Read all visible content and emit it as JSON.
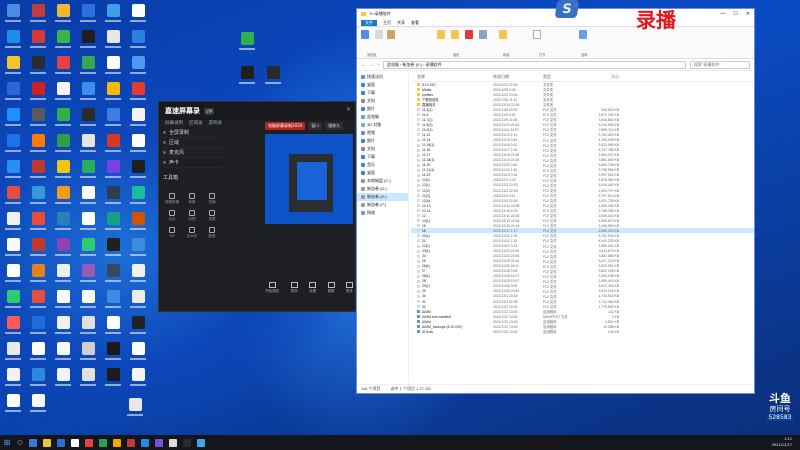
{
  "desktop": {
    "icon_colors": [
      "#4a8de0",
      "#c23d3d",
      "#f2b630",
      "#2f6fdc",
      "#3fa0e6",
      "#ffffff",
      "#1e8ee6",
      "#d33a3a",
      "#39b54a",
      "#1f1f1f",
      "#e7e7e7",
      "#2b7fe0",
      "#f7c12a",
      "#2b2b2b",
      "#e64242",
      "#35a853",
      "#ffffff",
      "#4f9af0",
      "#2a66d8",
      "#cc2222",
      "#f6f6f6",
      "#3f8cf0",
      "#ffb900",
      "#e03c31",
      "#1e90ff",
      "#5a5a5a",
      "#2fb24e",
      "#2b2b2b",
      "#3f7ee0",
      "#f4f4f4",
      "#1a73e8",
      "#ff7a00",
      "#2f9e44",
      "#e6e6e6",
      "#d9381e",
      "#ffffff",
      "#2a8ff2",
      "#c0392b",
      "#f1c40f",
      "#27ae60",
      "#7b3fe4",
      "#1e1e1e",
      "#e84c3d",
      "#3498db",
      "#f39c12",
      "#ffffff",
      "#2c3e50",
      "#1abc9c",
      "#f0f0f0",
      "#e74c3c",
      "#2980b9",
      "#ffffff",
      "#16a085",
      "#d35400",
      "#f9f9f9",
      "#c0392b",
      "#8e44ad",
      "#2ecc71",
      "#1f1f1f",
      "#3c8dde",
      "#ffffff",
      "#e67e22",
      "#ecf0f1",
      "#9b59b6",
      "#34495e",
      "#f1f1f1",
      "#2ecc71",
      "#e74c3c",
      "#ffffff",
      "#ffffff",
      "#3d8be2",
      "#ececec",
      "#ff5a5a",
      "#1d6fe0",
      "#f0f0f0",
      "#e0e0e0",
      "#ffffff",
      "#222222",
      "#eaeaea",
      "#ffffff",
      "#fafafa",
      "#d0d0d0",
      "#1a1a1a",
      "#ffffff",
      "#f2f2f2",
      "#2b8ae0",
      "#f4f4f4",
      "#e0e0e0",
      "#1b1b1b",
      "#f5f5f5",
      "#ffffff",
      "#f9f9f9"
    ]
  },
  "recorder": {
    "brand": "嘉速屏幕录",
    "version": "VIP",
    "tabs": [
      "屏幕录制",
      "区域录",
      "游戏录"
    ],
    "preview_tabs": [
      "电脑屏幕录制2020",
      "窗口",
      "摄像头"
    ],
    "left_items": [
      "全屏录制",
      "区域",
      "麦克风",
      "声卡"
    ],
    "tools_title": "工具箱",
    "tools": [
      "视频剪辑",
      "转换",
      "压缩",
      "合并",
      "分割",
      "录屏",
      "GIF",
      "去水印",
      "配音"
    ],
    "bottom": [
      "开始录制",
      "暂停",
      "设置",
      "摄像",
      "更多"
    ]
  },
  "explorer": {
    "title": "E:\\录播软件",
    "ribbon_tabs": [
      "文件",
      "主页",
      "共享",
      "查看"
    ],
    "ribbon_groups": [
      "剪贴板",
      "组织",
      "新建",
      "打开",
      "选择"
    ],
    "address": "此电脑 › 新加卷 (E:) › 录播软件",
    "search_placeholder": "搜索\"录播软件\"",
    "nav": [
      "快速访问",
      "桌面",
      "下载",
      "文档",
      "图片",
      "此电脑",
      "3D 对象",
      "视频",
      "图片",
      "文档",
      "下载",
      "音乐",
      "桌面",
      "本地磁盘 (C:)",
      "新加卷 (D:)",
      "新加卷 (E:)",
      "新加卷 (F:)",
      "网络"
    ],
    "columns": [
      "名称",
      "修改日期",
      "类型",
      "大小"
    ],
    "rows": [
      {
        "n": "8.10.19C",
        "d": "2021/1/22 22:18",
        "t": "文件夹",
        "s": ""
      },
      {
        "n": "Media",
        "d": "2021/4/28 3:42",
        "t": "文件夹",
        "s": ""
      },
      {
        "n": "profiles",
        "d": "2021/1/22 13:44",
        "t": "文件夹",
        "s": ""
      },
      {
        "n": "下载的插件",
        "d": "2021/7/30 11:11",
        "t": "文件夹",
        "s": ""
      },
      {
        "n": "直播相关",
        "d": "2021/12/14 22:36",
        "t": "文件夹",
        "s": ""
      },
      {
        "n": "11.3(1)",
        "d": "2021/11/8 22:05",
        "t": "FLV 文件",
        "s": "944,522 KB"
      },
      {
        "n": "11.6",
        "d": "2021/11/9 0:25",
        "t": "FLV 文件",
        "s": "2,672,199 KB"
      },
      {
        "n": "11.7(1)",
        "d": "2021/11/9 22:28",
        "t": "FLV 文件",
        "s": "3,046,862 KB"
      },
      {
        "n": "11.8(2)",
        "d": "2021/11/10 22:03",
        "t": "FLV 文件",
        "s": "3,214,550 KB"
      },
      {
        "n": "11.9(1)",
        "d": "2021/11/11 23:57",
        "t": "FLV 文件",
        "s": "2,890,114 KB"
      },
      {
        "n": "11.12",
        "d": "2021/11/13 1:12",
        "t": "FLV 文件",
        "s": "3,751,420 KB"
      },
      {
        "n": "11.14",
        "d": "2021/11/15 0:44",
        "t": "FLV 文件",
        "s": "4,190,305 KB"
      },
      {
        "n": "11.15(1)",
        "d": "2021/11/16 0:31",
        "t": "FLV 文件",
        "s": "3,512,980 KB"
      },
      {
        "n": "11.16",
        "d": "2021/11/17 1:05",
        "t": "FLV 文件",
        "s": "4,247,789 KB"
      },
      {
        "n": "11.17",
        "d": "2021/11/18 22:48",
        "t": "FLV 文件",
        "s": "2,964,207 KB"
      },
      {
        "n": "11.18(1)",
        "d": "2021/11/19 23:19",
        "t": "FLV 文件",
        "s": "3,881,640 KB"
      },
      {
        "n": "11.20",
        "d": "2021/11/21 0:52",
        "t": "FLV 文件",
        "s": "3,684,748 KB"
      },
      {
        "n": "11.21(1)",
        "d": "2021/11/22 1:40",
        "t": "FLV 文件",
        "s": "3,798,556 KB"
      },
      {
        "n": "11.22",
        "d": "2021/11/23 0:16",
        "t": "FLV 文件",
        "s": "2,997,901 KB"
      },
      {
        "n": "12(1)",
        "d": "2021/12/1 1:43",
        "t": "FLV 文件",
        "s": "1,578,381 KB"
      },
      {
        "n": "12(1)",
        "d": "2021/12/2 22:03",
        "t": "FLV 文件",
        "s": "2,016,443 KB"
      },
      {
        "n": "12(2)",
        "d": "2021/12/2 22:18",
        "t": "FLV 文件",
        "s": "1,904,797 KB"
      },
      {
        "n": "12(3)",
        "d": "2021/12/4 0:11",
        "t": "FLV 文件",
        "s": "3,797,510 KB"
      },
      {
        "n": "12(4)",
        "d": "2021/12/5 22:53",
        "t": "FLV 文件",
        "s": "3,001,728 KB"
      },
      {
        "n": "12.13",
        "d": "2021/12/14 22:58",
        "t": "FLV 文件",
        "s": "1,659,180 KB"
      },
      {
        "n": "12.14",
        "d": "2021/12/15 0:03",
        "t": "FLV 文件",
        "s": "2,748,296 KB"
      },
      {
        "n": "12",
        "d": "2021/12/11 22:28",
        "t": "FLV 文件",
        "s": "2,849,320 KB"
      },
      {
        "n": "14(1)",
        "d": "2021/12/13 22:18",
        "t": "FLV 文件",
        "s": "1,839,872 KB"
      },
      {
        "n": "15",
        "d": "2021/12/15 21:44",
        "t": "FLV 文件",
        "s": "2,446,599 KB"
      },
      {
        "n": "16",
        "d": "2021/12/17 1:17",
        "t": "FLV 文件",
        "s": "2,950,316 KB"
      },
      {
        "n": "20(1)",
        "d": "2021/11/21 1:05",
        "t": "FLV 文件",
        "s": "3,752,525 KB"
      },
      {
        "n": "21",
        "d": "2021/11/21 1:32",
        "t": "FLV 文件",
        "s": "4,041,225 KB"
      },
      {
        "n": "22(1)",
        "d": "2021/11/22 0:13",
        "t": "FLV 文件",
        "s": "2,889,401 KB"
      },
      {
        "n": "23(1)",
        "d": "2021/11/23 22:54",
        "t": "FLV 文件",
        "s": "3,113,675 KB"
      },
      {
        "n": "24",
        "d": "2021/11/24 23:56",
        "t": "FLV 文件",
        "s": "3,682,884 KB"
      },
      {
        "n": "25",
        "d": "2021/11/25 23:30",
        "t": "FLV 文件",
        "s": "3,417,223 KB"
      },
      {
        "n": "26(1)",
        "d": "2021/11/26 23:11",
        "t": "FLV 文件",
        "s": "2,823,051 KB"
      },
      {
        "n": "27",
        "d": "2021/11/28 0:05",
        "t": "FLV 文件",
        "s": "3,802,156 KB"
      },
      {
        "n": "28(1)",
        "d": "2021/11/28 14:07",
        "t": "FLV 文件",
        "s": "3,390,208 KB"
      },
      {
        "n": "28",
        "d": "2021/11/29 19:57",
        "t": "FLV 文件",
        "s": "2,995,418 KB"
      },
      {
        "n": "29(1)",
        "d": "2021/11/30 0:09",
        "t": "FLV 文件",
        "s": "2,847,392 KB"
      },
      {
        "n": "29",
        "d": "2021/11/30 23:54",
        "t": "FLV 文件",
        "s": "3,513,224 KB"
      },
      {
        "n": "30",
        "d": "2021/12/1 23:18",
        "t": "FLV 文件",
        "s": "1,744,918 KB"
      },
      {
        "n": "31",
        "d": "2021/12/2 22:38",
        "t": "FLV 文件",
        "s": "1,712,066 KB"
      },
      {
        "n": "32",
        "d": "2021/12/2 22:51",
        "t": "FLV 文件",
        "s": "1,775,690 KB"
      },
      {
        "n": "AIMM",
        "d": "2021/7/22 13:40",
        "t": "应用程序",
        "s": "111 KB"
      },
      {
        "n": "AIMM.exe.manifest",
        "d": "2021/7/22 13:40",
        "t": "MANIFEST 文件",
        "s": "2 KB"
      },
      {
        "n": "AIMnt",
        "d": "2021/7/22 13:40",
        "t": "应用程序",
        "s": "4,802 KB"
      },
      {
        "n": "AIMM_backups (8.10.19C)",
        "d": "2021/7/22 13:40",
        "t": "应用程序",
        "s": "10,288 KB"
      },
      {
        "n": "AITools",
        "d": "2021/7/22 13:40",
        "t": "应用程序",
        "s": "145 KB"
      }
    ],
    "selected_row": 29,
    "status_count": "118 个项目",
    "status_selected": "选中 1 个项目  1.37 GB"
  },
  "overlay": {
    "logo": "S",
    "record_label": "录播",
    "watermark_line1": "斗鱼",
    "watermark_line2": "房间号",
    "room_number": "528583"
  },
  "taskbar": {
    "time": "1:11",
    "date": "2021/12/17",
    "app_colors": [
      "#3a78d8",
      "#f0c23b",
      "#2d6fd2",
      "#ffffff",
      "#e64141",
      "#2aa14a",
      "#f2a900",
      "#c13b3b",
      "#1e8ee6",
      "#7a4fe0",
      "#dcdcdc",
      "#2b2b2b",
      "#3fa3f0"
    ]
  }
}
